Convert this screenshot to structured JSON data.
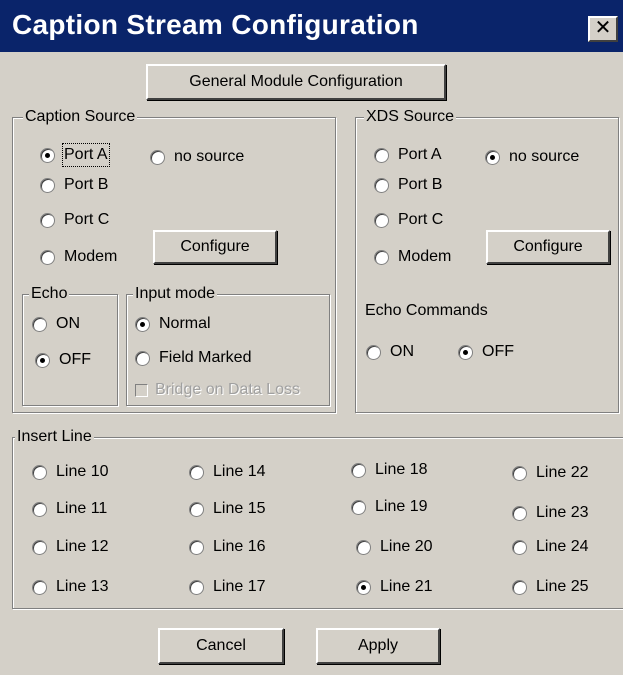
{
  "window": {
    "title": "Caption Stream Configuration",
    "close_glyph": "✕"
  },
  "general_button": "General  Module Configuration",
  "caption_source": {
    "legend": "Caption Source",
    "options": [
      "Port A",
      "Port B",
      "Port C",
      "Modem",
      "no source"
    ],
    "selected": "Port A",
    "configure": "Configure"
  },
  "xds_source": {
    "legend": "XDS Source",
    "options": [
      "Port A",
      "Port B",
      "Port C",
      "Modem",
      "no source"
    ],
    "selected": "no source",
    "configure": "Configure",
    "echo_label": "Echo Commands",
    "echo_options": [
      "ON",
      "OFF"
    ],
    "echo_selected": "OFF"
  },
  "echo": {
    "legend": "Echo",
    "options": [
      "ON",
      "OFF"
    ],
    "selected": "OFF"
  },
  "input_mode": {
    "legend": "Input mode",
    "options": [
      "Normal",
      "Field Marked"
    ],
    "selected": "Normal",
    "bridge_label": "Bridge on Data Loss",
    "bridge_checked": false
  },
  "insert_line": {
    "legend": "Insert Line",
    "lines": [
      "Line 10",
      "Line 11",
      "Line 12",
      "Line 13",
      "Line 14",
      "Line 15",
      "Line 16",
      "Line 17",
      "Line 18",
      "Line 19",
      "Line 20",
      "Line 21",
      "Line 22",
      "Line 23",
      "Line 24",
      "Line 25"
    ],
    "selected": "Line 21"
  },
  "buttons": {
    "cancel": "Cancel",
    "apply": "Apply"
  },
  "colors": {
    "titlebar": "#0a246a",
    "face": "#d4d0c8"
  }
}
